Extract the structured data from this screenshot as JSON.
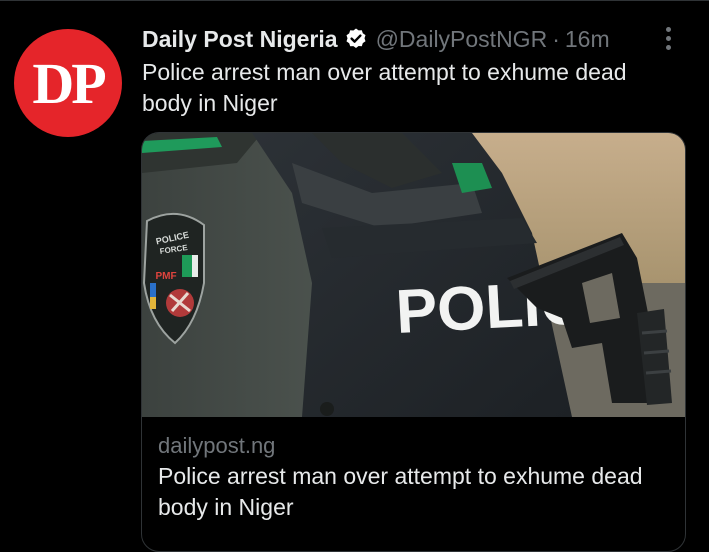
{
  "tweet": {
    "avatar_text": "DP",
    "author_name": "Daily Post Nigeria",
    "handle": "@DailyPostNGR",
    "separator": "·",
    "time": "16m",
    "text": "Police arrest man over attempt to exhume dead body in Niger"
  },
  "card": {
    "image_text": "POLIC",
    "patch_text_top": "POLICE",
    "patch_text_mid": "FORCE",
    "patch_text_pmf": "PMF",
    "domain": "dailypost.ng",
    "title": "Police arrest man over attempt to exhume dead body in Niger"
  },
  "colors": {
    "background": "#000000",
    "avatar": "#e5252a",
    "primary_text": "#e7e9ea",
    "secondary_text": "#71767b",
    "border": "#2f3336",
    "verified": "#ffffff"
  },
  "icons": {
    "verified": "verified-badge-icon",
    "more": "more-dots-icon"
  }
}
